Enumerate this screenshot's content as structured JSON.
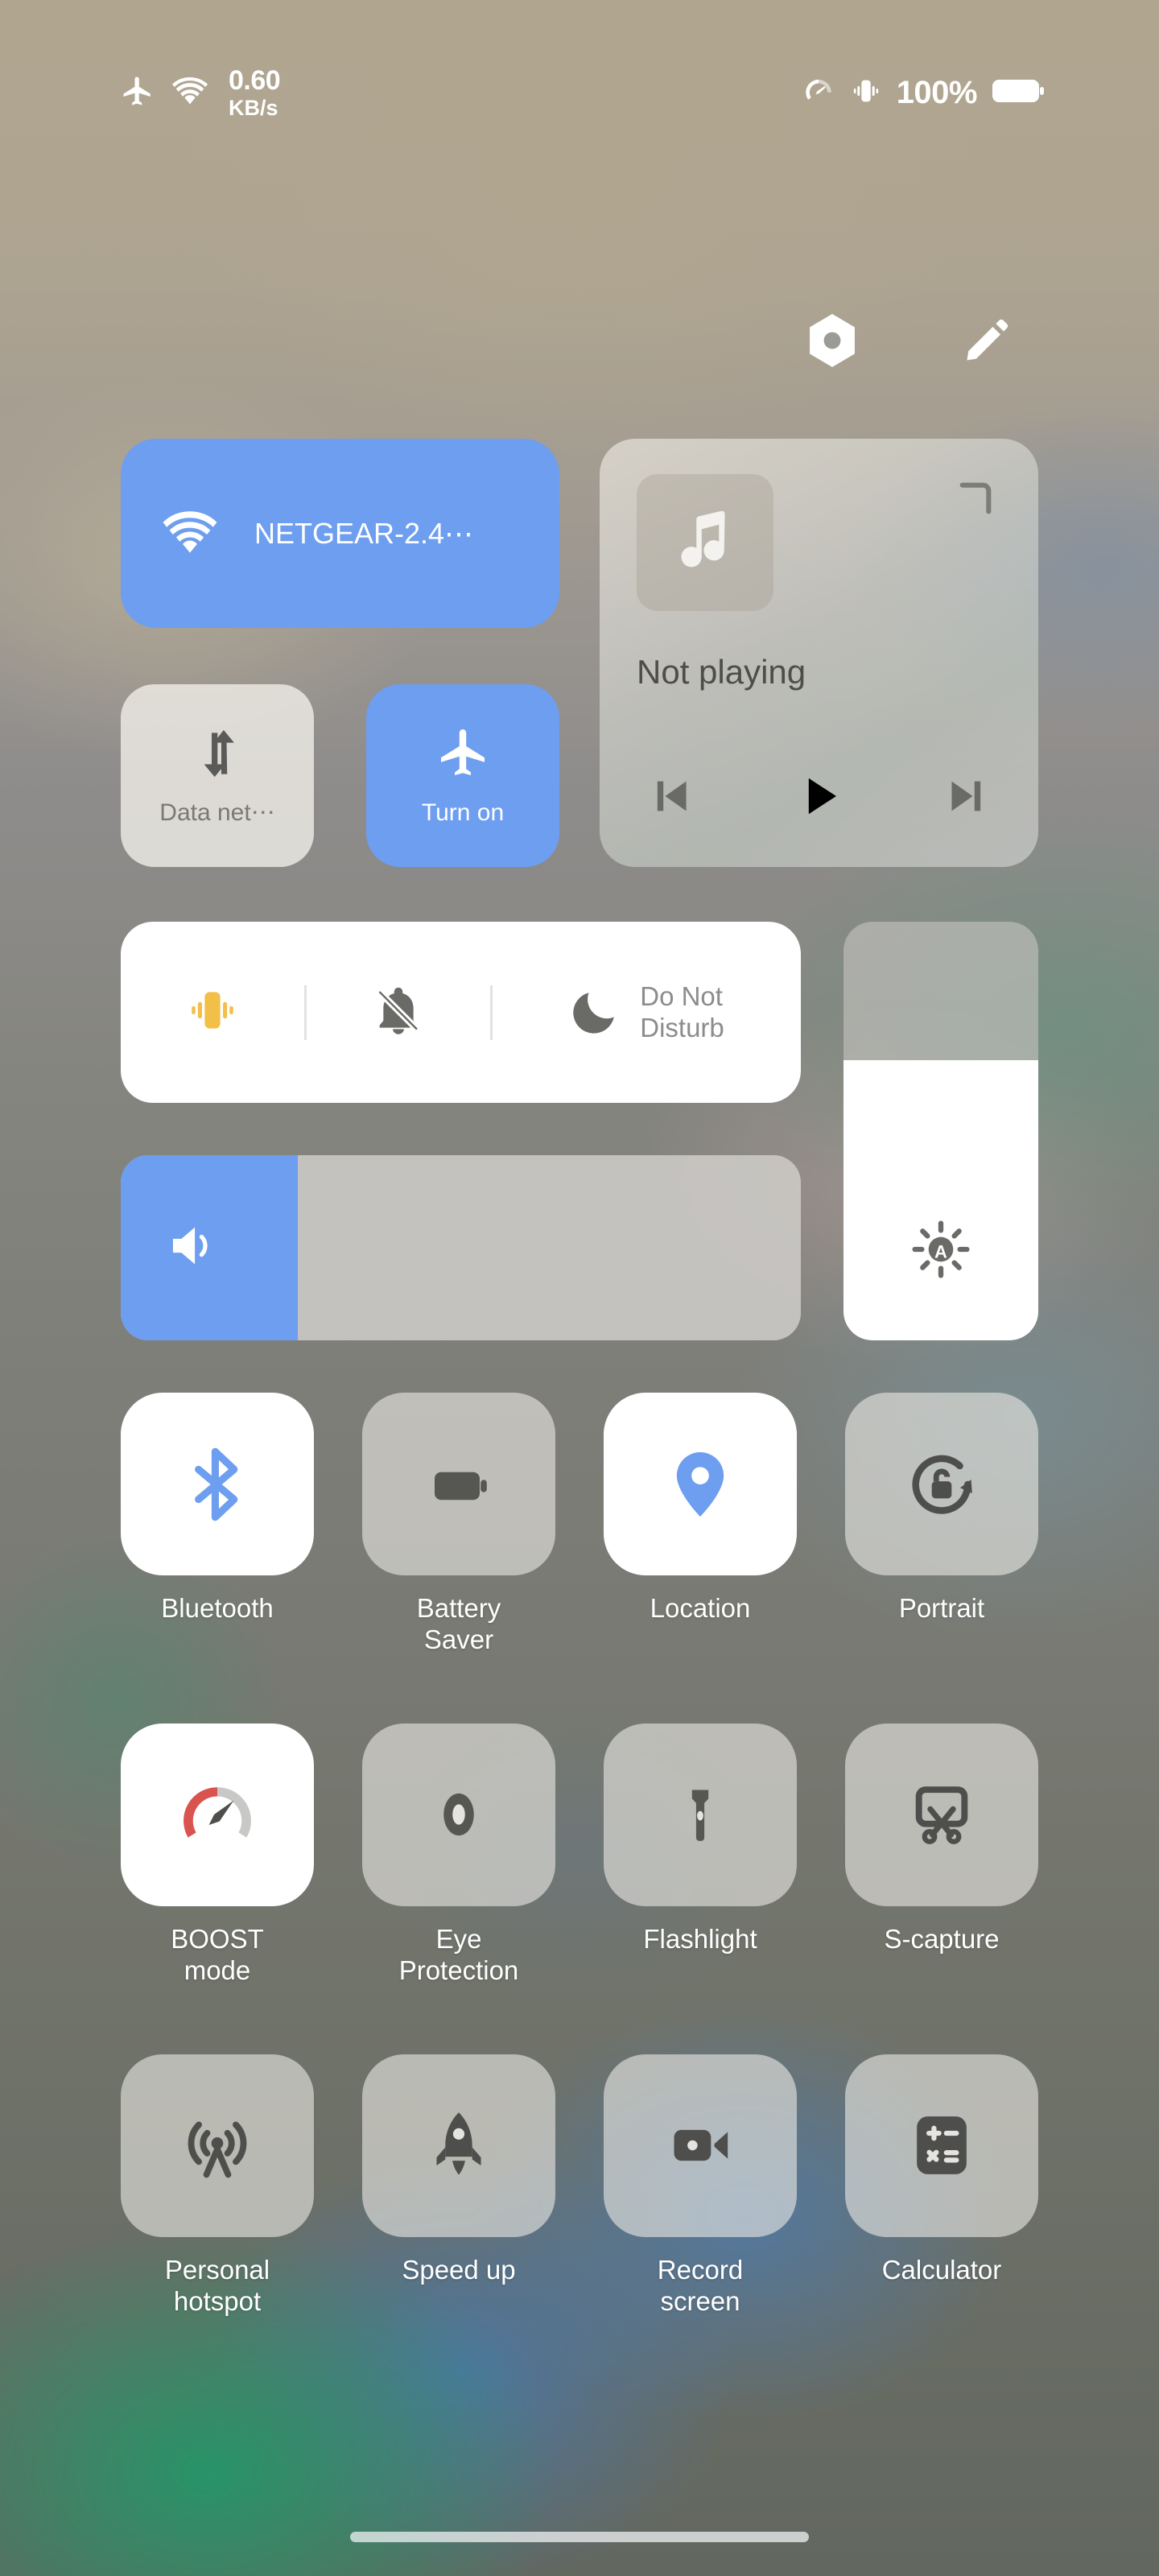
{
  "status_bar": {
    "airplane_icon": "airplane-icon",
    "wifi_icon": "wifi-icon",
    "net_speed_value": "0.60",
    "net_speed_unit": "KB/s",
    "speedometer_icon": "speedometer-icon",
    "vibrate_icon": "vibrate-icon",
    "battery_percent": "100%",
    "battery_icon": "battery-full-icon"
  },
  "header": {
    "settings_icon": "hex-nut-settings-icon",
    "edit_icon": "pencil-edit-icon"
  },
  "connectivity": {
    "wifi": {
      "label": "NETGEAR-2.4⋯",
      "icon": "wifi-icon",
      "state": "on"
    },
    "data_network": {
      "label": "Data net⋯",
      "icon": "data-transfer-icon",
      "state": "off"
    },
    "airplane_mode": {
      "label": "Turn on",
      "icon": "airplane-icon",
      "state": "on"
    }
  },
  "media": {
    "album_art_icon": "music-note-icon",
    "title": "Not playing",
    "cast_icon": "corner-expand-icon",
    "previous_label": "previous-track-icon",
    "play_label": "play-icon",
    "next_label": "next-track-icon"
  },
  "sound_mode": {
    "vibrate": {
      "icon": "vibrate-icon",
      "state": "on",
      "color": "#f2c049"
    },
    "silent": {
      "icon": "bell-off-icon",
      "state": "off"
    },
    "do_not_disturb": {
      "icon": "moon-icon",
      "label": "Do Not\nDisturb",
      "state": "off"
    }
  },
  "volume": {
    "icon": "speaker-icon",
    "level_percent": 26,
    "fill_color": "#6e9ef0"
  },
  "brightness": {
    "icon": "auto-brightness-icon",
    "level_percent": 67,
    "auto_letter": "A"
  },
  "quick_settings": [
    {
      "label": "Bluetooth",
      "icon": "bluetooth-icon",
      "state": "on"
    },
    {
      "label": "Battery\nSaver",
      "icon": "battery-saver-icon",
      "state": "off"
    },
    {
      "label": "Location",
      "icon": "location-pin-icon",
      "state": "on"
    },
    {
      "label": "Portrait",
      "icon": "rotation-lock-icon",
      "state": "off"
    },
    {
      "label": "BOOST\nmode",
      "icon": "gauge-icon",
      "state": "on"
    },
    {
      "label": "Eye\nProtection",
      "icon": "eye-icon",
      "state": "off"
    },
    {
      "label": "Flashlight",
      "icon": "flashlight-icon",
      "state": "off"
    },
    {
      "label": "S-capture",
      "icon": "screenshot-scissors-icon",
      "state": "off"
    },
    {
      "label": "Personal\nhotspot",
      "icon": "hotspot-icon",
      "state": "off"
    },
    {
      "label": "Speed up",
      "icon": "rocket-icon",
      "state": "off"
    },
    {
      "label": "Record\nscreen",
      "icon": "video-camera-icon",
      "state": "off"
    },
    {
      "label": "Calculator",
      "icon": "calculator-icon",
      "state": "off"
    }
  ],
  "colors": {
    "accent_blue": "#6e9ef0",
    "vibrate_yellow": "#f2c049",
    "icon_dark": "#5a5a58",
    "boost_red": "#d9534f"
  },
  "navigation": {
    "home_indicator": "home-indicator-bar"
  }
}
